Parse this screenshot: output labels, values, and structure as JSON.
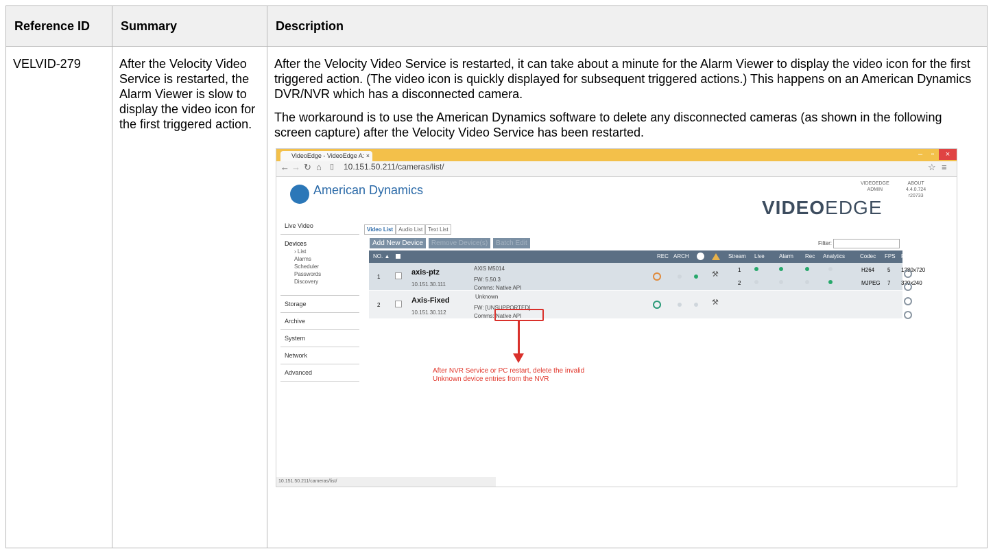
{
  "table": {
    "headers": [
      "Reference ID",
      "Summary",
      "Description"
    ],
    "row": {
      "ref_id": "VELVID-279",
      "summary": "After the Velocity Video Service is restarted, the Alarm Viewer is slow to display the video icon for the first triggered action.",
      "desc_p1": "After the Velocity Video Service is restarted, it can take about a minute for the Alarm Viewer to display the video icon for the first triggered action.  (The video icon is quickly displayed for subsequent triggered actions.)  This happens on an American Dynamics DVR/NVR which has a disconnected camera.",
      "desc_p2": "The workaround is to use the American Dynamics software to delete any disconnected cameras (as shown in the following screen capture) after the Velocity Video Service has been restarted."
    }
  },
  "screenshot": {
    "tab_title": "VideoEdge - VideoEdge A:",
    "url": "10.151.50.211/cameras/list/",
    "brand": "American Dynamics",
    "product_logo_bold": "VIDEO",
    "product_logo_light": "EDGE",
    "header_info": {
      "left": [
        "VIDEOEDGE",
        "ADMIN"
      ],
      "right": [
        "ABOUT",
        "4.4.0.724",
        "r20733"
      ]
    },
    "sidebar": {
      "live_video": "Live Video",
      "devices": "Devices",
      "devices_sub": [
        "› List",
        "Alarms",
        "Scheduler",
        "Passwords",
        "Discovery"
      ],
      "others": [
        "Storage",
        "Archive",
        "System",
        "Network",
        "Advanced"
      ]
    },
    "view_tabs": [
      "Video List",
      "Audio List",
      "Text List"
    ],
    "toolbar": {
      "add": "Add New Device",
      "remove": "Remove Device(s)",
      "batch": "Batch Edit",
      "filter_label": "Filter:"
    },
    "grid_headers": [
      "NO. ▲",
      "REC",
      "ARCH",
      "Stream",
      "Live",
      "Alarm",
      "Rec",
      "Analytics",
      "Codec",
      "FPS",
      "Resolution"
    ],
    "devices": [
      {
        "no": "1",
        "name": "axis-ptz",
        "ip": "10.151.30.111",
        "model": "AXIS M5014",
        "fw": "FW: 5.50.3",
        "comms": "Comms: Native API",
        "streams": [
          {
            "stream": "1",
            "codec": "H264",
            "fps": "5",
            "resolution": "1280x720"
          },
          {
            "stream": "2",
            "codec": "MJPEG",
            "fps": "7",
            "resolution": "320x240"
          }
        ]
      },
      {
        "no": "2",
        "name": "Axis-Fixed",
        "ip": "10.151.30.112",
        "model": "Unknown",
        "fw": "FW: [UNSUPPORTED]",
        "comms": "Comms: Native API"
      }
    ],
    "annotation_line1": "After NVR Service or PC restart, delete the invalid",
    "annotation_line2": "Unknown device entries from the NVR",
    "status_url": "10.151.50.211/cameras/list/",
    "accent_color": "#f3c04a",
    "annotation_color": "#d9302b"
  }
}
